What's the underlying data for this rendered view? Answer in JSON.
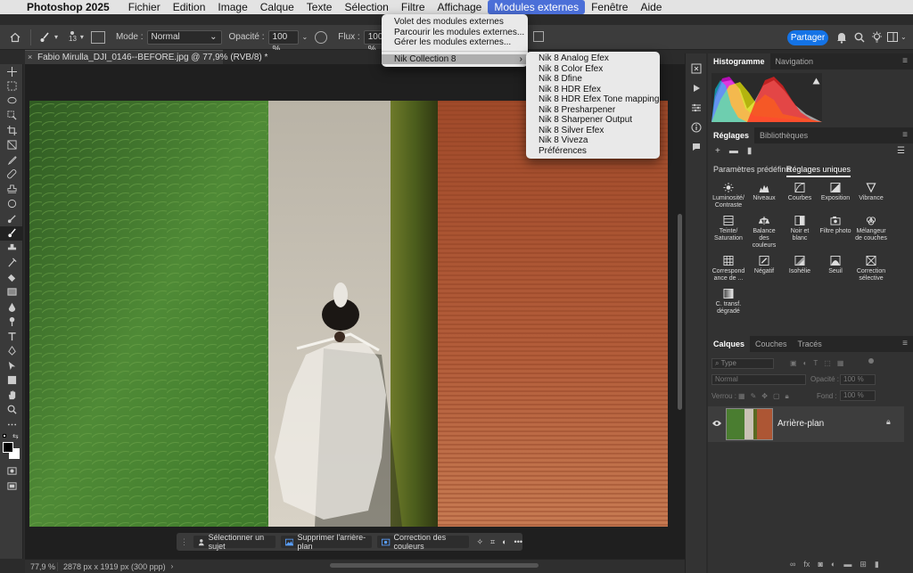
{
  "menubar": {
    "app": "Photoshop 2025",
    "items": [
      "Fichier",
      "Edition",
      "Image",
      "Calque",
      "Texte",
      "Sélection",
      "Filtre",
      "Affichage",
      "Modules externes",
      "Fenêtre",
      "Aide"
    ]
  },
  "optbar": {
    "brush_size": "13",
    "mode_label": "Mode :",
    "mode_value": "Normal",
    "opacity_label": "Opacité :",
    "opacity_value": "100 %",
    "flux_label": "Flux :",
    "flux_value": "100 %"
  },
  "share_label": "Partager",
  "doc_tab": "Fabio Mirulla_DJI_0146--BEFORE.jpg @ 77,9% (RVB/8) *",
  "plugins_menu": {
    "items": [
      "Volet des modules externes",
      "Parcourir les modules externes...",
      "Gérer les modules externes..."
    ],
    "highlight": "Nik Collection 8"
  },
  "nik_menu": [
    "Nik 8 Analog Efex",
    "Nik 8 Color Efex",
    "Nik 8 Dfine",
    "Nik 8 HDR Efex",
    "Nik 8 HDR Efex Tone mapping",
    "Nik 8 Presharpener",
    "Nik 8 Sharpener Output",
    "Nik 8 Silver Efex",
    "Nik 8 Viveza",
    "Préférences"
  ],
  "context_bar": {
    "select_subject": "Sélectionner un sujet",
    "remove_bg": "Supprimer l'arrière-plan",
    "color_correction": "Correction des couleurs"
  },
  "status": {
    "zoom": "77,9 %",
    "info": "2878 px x 1919 px (300 ppp)"
  },
  "histogram_tabs": [
    "Histogramme",
    "Navigation"
  ],
  "adjust_tabs": [
    "Réglages",
    "Bibliothèques"
  ],
  "adjust_subtabs": [
    "Paramètres prédéfinis",
    "Réglages uniques"
  ],
  "adjustments": [
    "Luminosité/ Contraste",
    "Niveaux",
    "Courbes",
    "Exposition",
    "Vibrance",
    "Teinte/ Saturation",
    "Balance des couleurs",
    "Noir et blanc",
    "Filtre photo",
    "Mélangeur de couches",
    "Correspond ance de ...",
    "Négatif",
    "Isohélie",
    "Seuil",
    "Correction sélective",
    "C. transf. dégradé"
  ],
  "layers_tabs": [
    "Calques",
    "Couches",
    "Tracés"
  ],
  "layers": {
    "filter_label": "Type",
    "blend_mode": "Normal",
    "opacity_label": "Opacité :",
    "opacity_value": "100 %",
    "lock_label": "Verrou :",
    "fill_label": "Fond :",
    "fill_value": "100 %",
    "items": [
      {
        "name": "Arrière-plan"
      }
    ]
  },
  "colors": {
    "accent": "#1473e6",
    "menu_highlight": "#4b6fd8"
  }
}
